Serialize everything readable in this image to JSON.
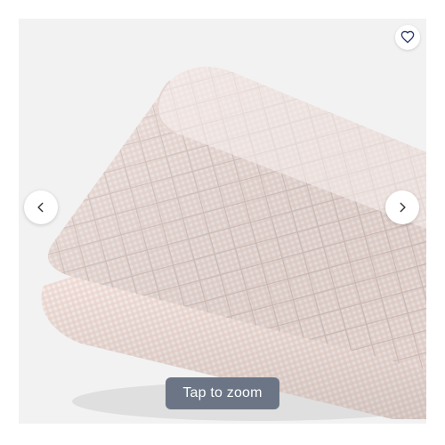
{
  "zoom": {
    "label": "Tap to zoom"
  },
  "icons": {
    "favorite": "heart-icon",
    "previous": "chevron-left-icon",
    "next": "chevron-right-icon"
  },
  "colors": {
    "favorite_icon": "#2b3a67",
    "zoom_pill_bg": "#6b7585",
    "pad_fabric": "#f3e9e6",
    "gingham_line": "#e3b8b0"
  }
}
